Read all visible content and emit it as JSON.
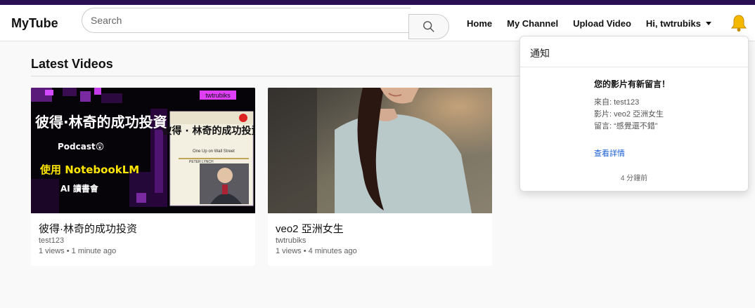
{
  "app": {
    "brand": "MyTube"
  },
  "search": {
    "placeholder": "Search",
    "value": ""
  },
  "nav": {
    "home": "Home",
    "my_channel": "My Channel",
    "upload": "Upload Video",
    "user": "Hi, twtrubiks"
  },
  "main": {
    "section_title": "Latest Videos",
    "videos": [
      {
        "title": "彼得·林奇的成功投资",
        "author": "test123",
        "meta": "1 views • 1 minute ago",
        "thumb": {
          "badge": "twtrubiks",
          "line1": "彼得·林奇的成功投資",
          "line2": "Podcast😲",
          "line3": "使用 NotebookLM",
          "line4": "AI 讀書會",
          "book_title": "彼得 · 林奇的成功投資",
          "book_sub": "One Up on Wall Street",
          "book_author": "PETER LYNCH"
        }
      },
      {
        "title": "veo2 亞洲女生",
        "author": "twtrubiks",
        "meta": "1 views • 4 minutes ago"
      }
    ]
  },
  "notification": {
    "header": "通知",
    "title": "您的影片有新留言！",
    "from": "來自: test123",
    "video": "影片: veo2 亞洲女生",
    "comment": "留言: “感覺還不錯”",
    "link": "查看詳情",
    "time": "4 分鐘前"
  },
  "colors": {
    "topbar": "#2a0f55",
    "accent_yellow": "#ffe600",
    "badge": "#e040fb",
    "link": "#1a5fd6"
  }
}
